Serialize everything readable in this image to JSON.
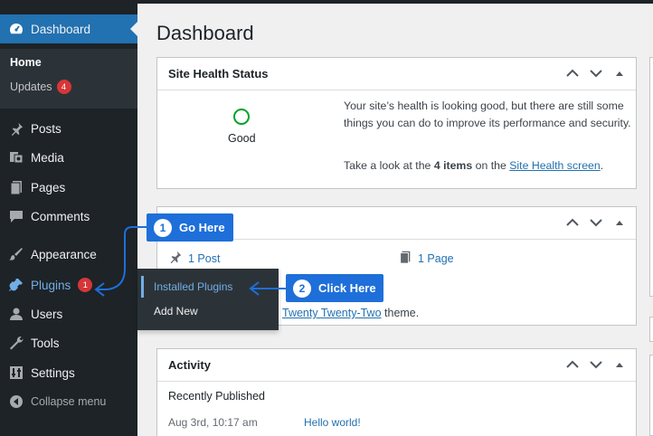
{
  "sidebar": {
    "dashboard": "Dashboard",
    "home": "Home",
    "updates": "Updates",
    "updates_count": "4",
    "posts": "Posts",
    "media": "Media",
    "pages": "Pages",
    "comments": "Comments",
    "appearance": "Appearance",
    "plugins": "Plugins",
    "plugins_count": "1",
    "users": "Users",
    "tools": "Tools",
    "settings": "Settings",
    "collapse": "Collapse menu"
  },
  "flyout": {
    "installed": "Installed Plugins",
    "add_new": "Add New"
  },
  "main": {
    "title": "Dashboard",
    "site_health": {
      "title": "Site Health Status",
      "status": "Good",
      "message": "Your site’s health is looking good, but there are still some things you can do to improve its performance and security.",
      "look_prefix": "Take a look at the ",
      "items": "4 items",
      "on_the": " on the ",
      "link": "Site Health screen",
      "period": "."
    },
    "glance": {
      "posts": "1 Post",
      "pages": "1 Page",
      "theme_link": "Twenty Twenty-Two",
      "theme_suffix": " theme."
    },
    "activity": {
      "title": "Activity",
      "recently_published": "Recently Published",
      "date": "Aug 3rd, 10:17 am",
      "post_link": "Hello world!"
    }
  },
  "callouts": {
    "one_num": "1",
    "one_label": "Go Here",
    "two_num": "2",
    "two_label": "Click Here"
  },
  "colors": {
    "sidebar": "#1d2327",
    "accent": "#2271b1",
    "callout": "#1e6fd9",
    "badge": "#d63638",
    "health_good": "#00a32a"
  }
}
